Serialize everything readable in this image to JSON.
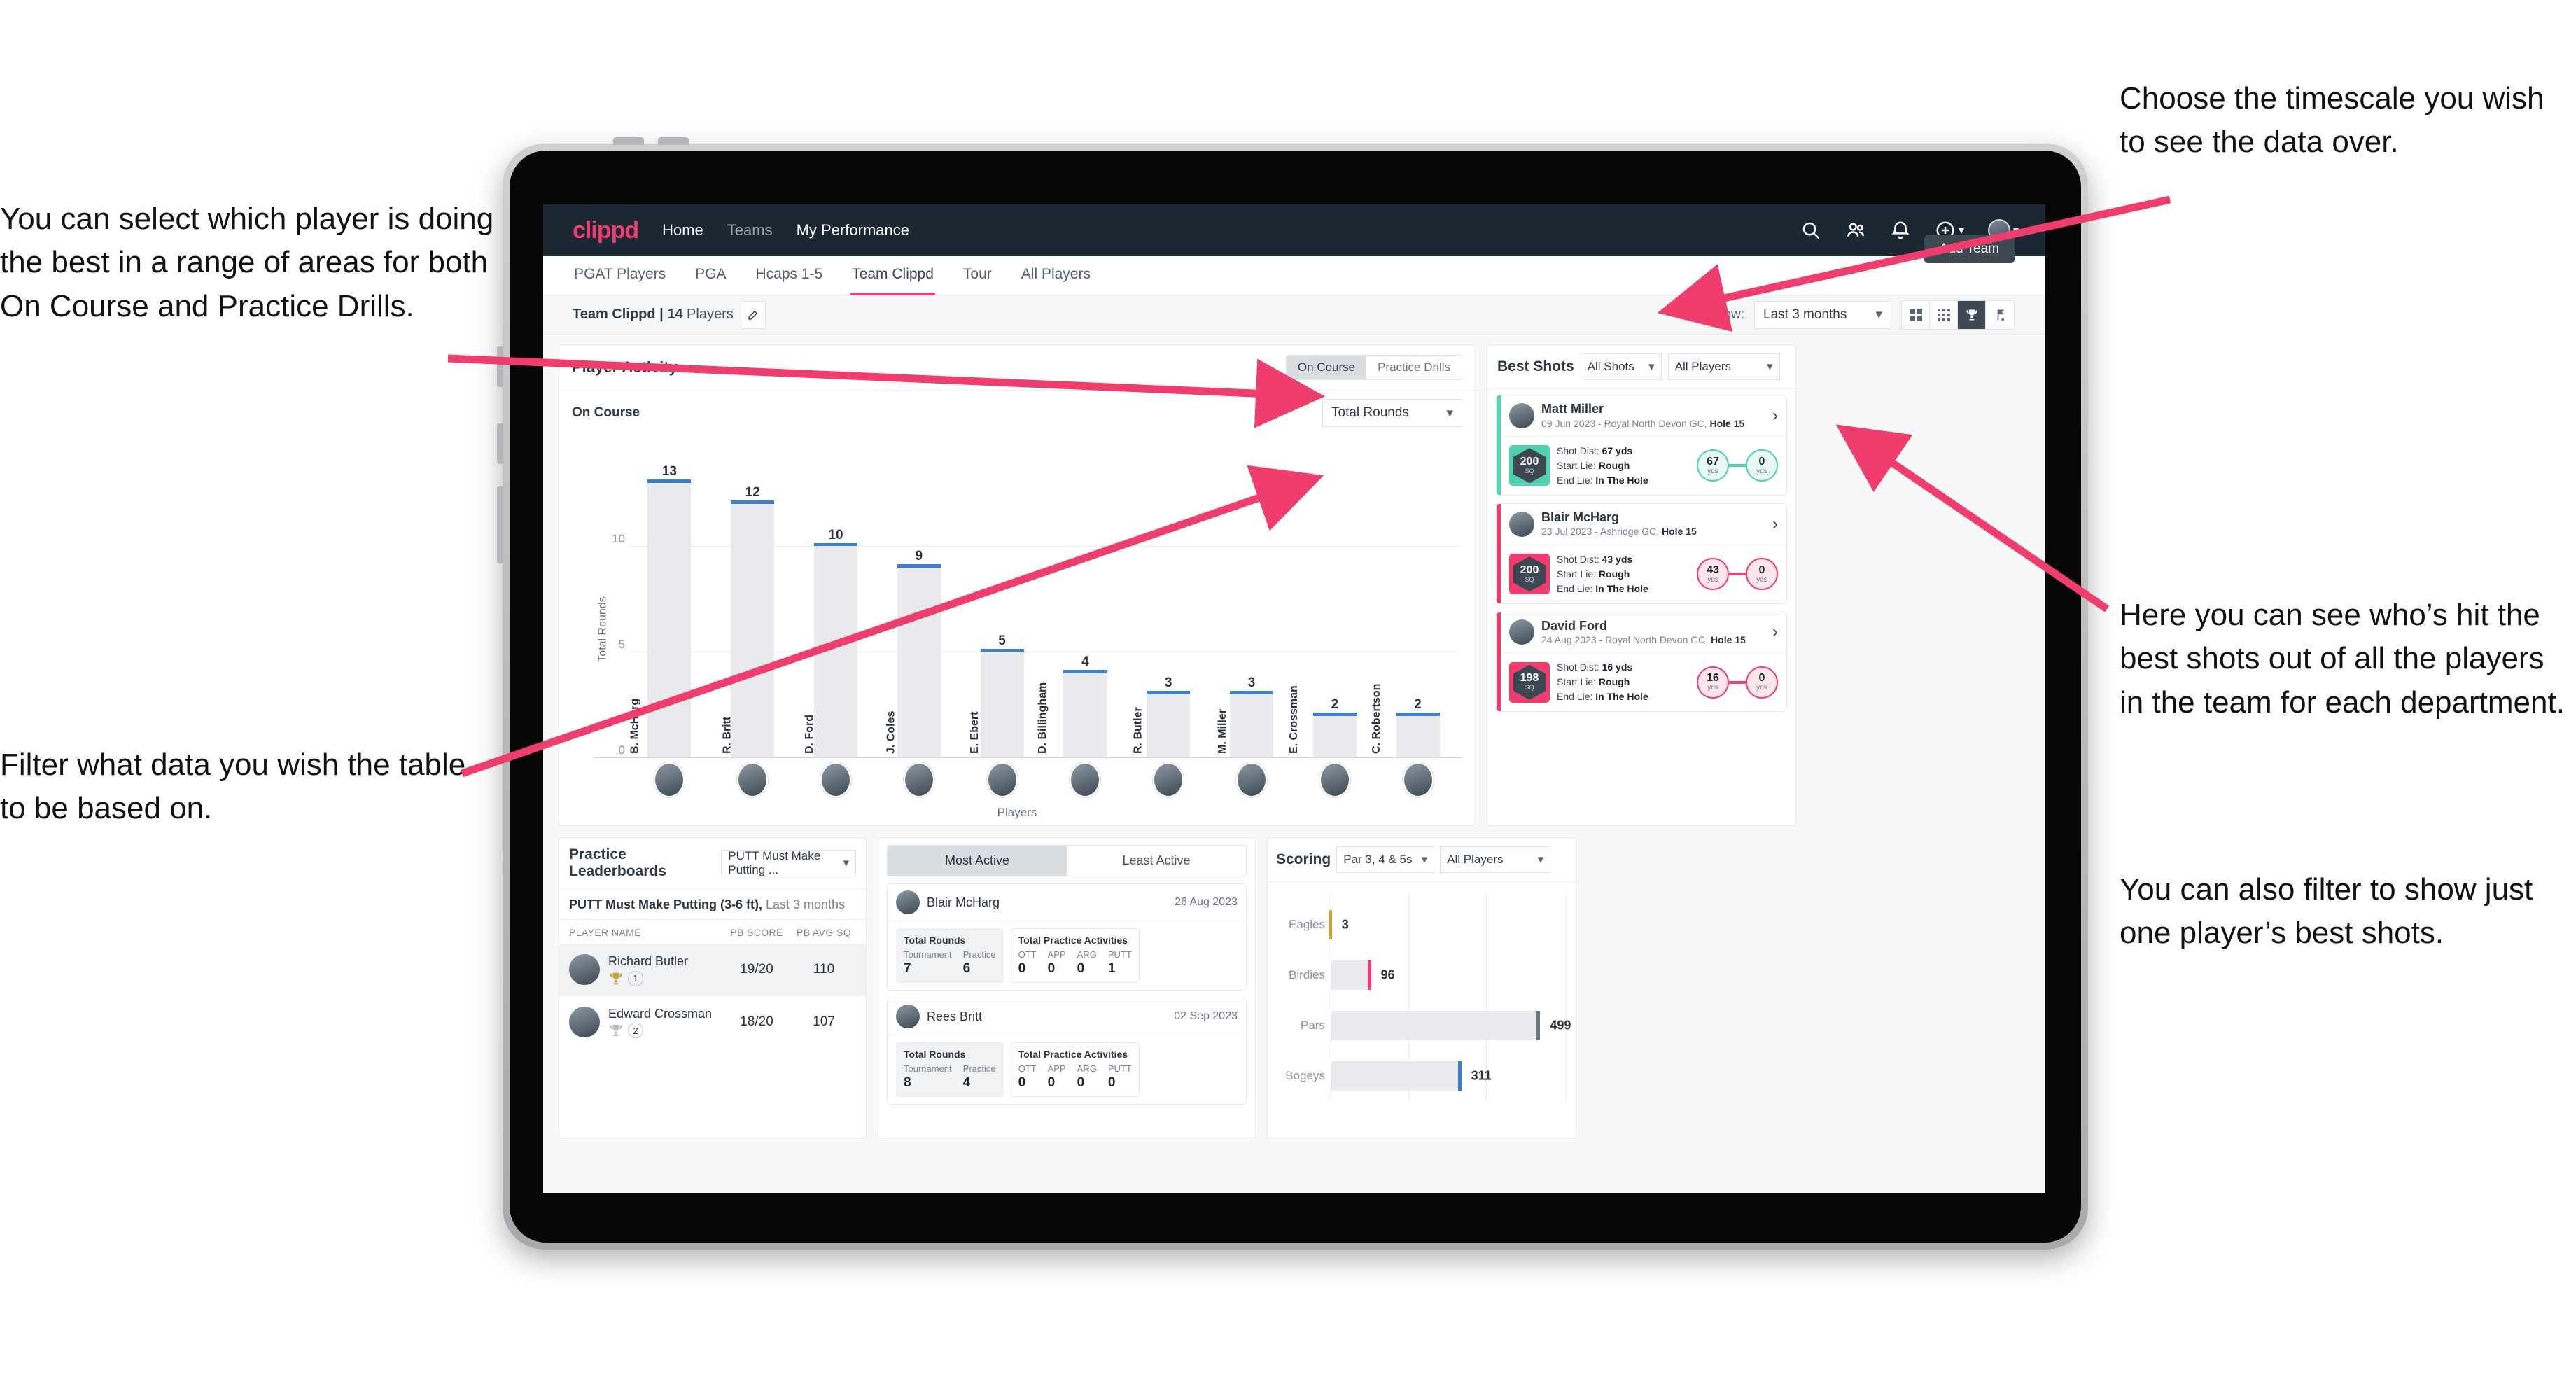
{
  "annotations": {
    "left_top": "You can select which player is doing the best in a range of areas for both On Course and Practice Drills.",
    "left_bottom": "Filter what data you wish the table to be based on.",
    "right_top": "Choose the timescale you wish to see the data over.",
    "right_middle": "Here you can see who’s hit the best shots out of all the players in the team for each department.",
    "right_bottom": "You can also filter to show just one player’s best shots."
  },
  "topnav": {
    "logo": "clippd",
    "links": [
      {
        "label": "Home",
        "active": true
      },
      {
        "label": "Teams",
        "active": false
      },
      {
        "label": "My Performance",
        "active": false
      }
    ],
    "icons": [
      "search-icon",
      "people-icon",
      "bell-icon",
      "plus-circle-icon",
      "avatar"
    ]
  },
  "tabs": [
    {
      "label": "PGAT Players",
      "active": false
    },
    {
      "label": "PGA",
      "active": false
    },
    {
      "label": "Hcaps 1-5",
      "active": false
    },
    {
      "label": "Team Clippd",
      "active": true
    },
    {
      "label": "Tour",
      "active": false
    },
    {
      "label": "All Players",
      "active": false
    }
  ],
  "add_team_button": "Add Team",
  "subbar": {
    "team_title_bold": "Team Clippd | 14",
    "team_title_light": " Players",
    "show_label": "Show:",
    "show_value": "Last 3 months",
    "view_buttons": [
      "grid-large-icon",
      "grid-small-icon",
      "trophy-icon",
      "flag-icon"
    ],
    "active_view": "trophy-icon"
  },
  "player_activity": {
    "title": "Player Activity",
    "segments": [
      {
        "label": "On Course",
        "active": true
      },
      {
        "label": "Practice Drills",
        "active": false
      }
    ],
    "subtitle": "On Course",
    "metric_select": "Total Rounds"
  },
  "chart_data": {
    "type": "bar",
    "title": "Player Activity",
    "xlabel": "Players",
    "ylabel": "Total Rounds",
    "ylim": [
      0,
      14
    ],
    "yticks": [
      0,
      5,
      10
    ],
    "grid": true,
    "categories": [
      "B. McHarg",
      "R. Britt",
      "D. Ford",
      "J. Coles",
      "E. Ebert",
      "D. Billingham",
      "R. Butler",
      "M. Miller",
      "E. Crossman",
      "C. Robertson"
    ],
    "values": [
      13,
      12,
      10,
      9,
      5,
      4,
      3,
      3,
      2,
      2
    ],
    "bar_color": "#e8eaee",
    "cap_color": "#3a7fd5"
  },
  "best_shots": {
    "title": "Best Shots",
    "filter_shots": "All Shots",
    "filter_players": "All Players",
    "items": [
      {
        "name": "Matt Miller",
        "meta_date": "09 Jun 2023 - Royal North Devon GC, ",
        "meta_hole": "Hole 15",
        "sq": "200",
        "sq_unit": "SQ",
        "accent": "#4fd1ad",
        "shot_dist_label": "Shot Dist: ",
        "shot_dist": "67 yds",
        "start_lie_label": "Start Lie: ",
        "start_lie": "Rough",
        "end_lie_label": "End Lie: ",
        "end_lie": "In The Hole",
        "from": "67",
        "from_unit": "yds",
        "to": "0",
        "to_unit": "yds"
      },
      {
        "name": "Blair McHarg",
        "meta_date": "23 Jul 2023 - Ashridge GC, ",
        "meta_hole": "Hole 15",
        "sq": "200",
        "sq_unit": "SQ",
        "accent": "#ef3e6d",
        "shot_dist_label": "Shot Dist: ",
        "shot_dist": "43 yds",
        "start_lie_label": "Start Lie: ",
        "start_lie": "Rough",
        "end_lie_label": "End Lie: ",
        "end_lie": "In The Hole",
        "from": "43",
        "from_unit": "yds",
        "to": "0",
        "to_unit": "yds"
      },
      {
        "name": "David Ford",
        "meta_date": "24 Aug 2023 - Royal North Devon GC, ",
        "meta_hole": "Hole 15",
        "sq": "198",
        "sq_unit": "SQ",
        "accent": "#ef3e6d",
        "shot_dist_label": "Shot Dist: ",
        "shot_dist": "16 yds",
        "start_lie_label": "Start Lie: ",
        "start_lie": "Rough",
        "end_lie_label": "End Lie: ",
        "end_lie": "In The Hole",
        "from": "16",
        "from_unit": "yds",
        "to": "0",
        "to_unit": "yds"
      }
    ]
  },
  "practice_leaderboards": {
    "title": "Practice Leaderboards",
    "select": "PUTT Must Make Putting ...",
    "subtitle_bold": "PUTT Must Make Putting (3-6 ft),",
    "subtitle_light": " Last 3 months",
    "columns": [
      "PLAYER NAME",
      "PB SCORE",
      "PB AVG SQ"
    ],
    "rows": [
      {
        "name": "Richard Butler",
        "rank": "1",
        "trophy": "gold",
        "pb_score": "19/20",
        "pb_avg_sq": "110"
      },
      {
        "name": "Edward Crossman",
        "rank": "2",
        "trophy": "silver",
        "pb_score": "18/20",
        "pb_avg_sq": "107"
      }
    ]
  },
  "activity_panel": {
    "tabs": [
      {
        "label": "Most Active",
        "active": true
      },
      {
        "label": "Least Active",
        "active": false
      }
    ],
    "rounds_title": "Total Rounds",
    "practice_title": "Total Practice Activities",
    "rounds_keys": [
      "Tournament",
      "Practice"
    ],
    "practice_keys": [
      "OTT",
      "APP",
      "ARG",
      "PUTT"
    ],
    "cards": [
      {
        "name": "Blair McHarg",
        "date": "26 Aug 2023",
        "rounds": [
          "7",
          "6"
        ],
        "practice": [
          "0",
          "0",
          "0",
          "1"
        ]
      },
      {
        "name": "Rees Britt",
        "date": "02 Sep 2023",
        "rounds": [
          "8",
          "4"
        ],
        "practice": [
          "0",
          "0",
          "0",
          "0"
        ]
      }
    ]
  },
  "scoring": {
    "title": "Scoring",
    "filter_par": "Par 3, 4 & 5s",
    "filter_players": "All Players"
  },
  "scoring_chart": {
    "type": "bar",
    "orientation": "horizontal",
    "title": "Scoring",
    "categories": [
      "Eagles",
      "Birdies",
      "Pars",
      "Bogeys"
    ],
    "values": [
      3,
      96,
      499,
      311
    ],
    "xlim": [
      0,
      560
    ],
    "grid": true,
    "cap_colors": [
      "#c9a33c",
      "#ef3e6d",
      "#6b7682",
      "#3a7fd5"
    ],
    "bar_color": "#e8eaee"
  },
  "colors": {
    "brand_pink": "#ef3e6d",
    "nav_dark": "#1b2733",
    "bar_blue": "#3a7fd5",
    "teal": "#4fd1ad"
  }
}
